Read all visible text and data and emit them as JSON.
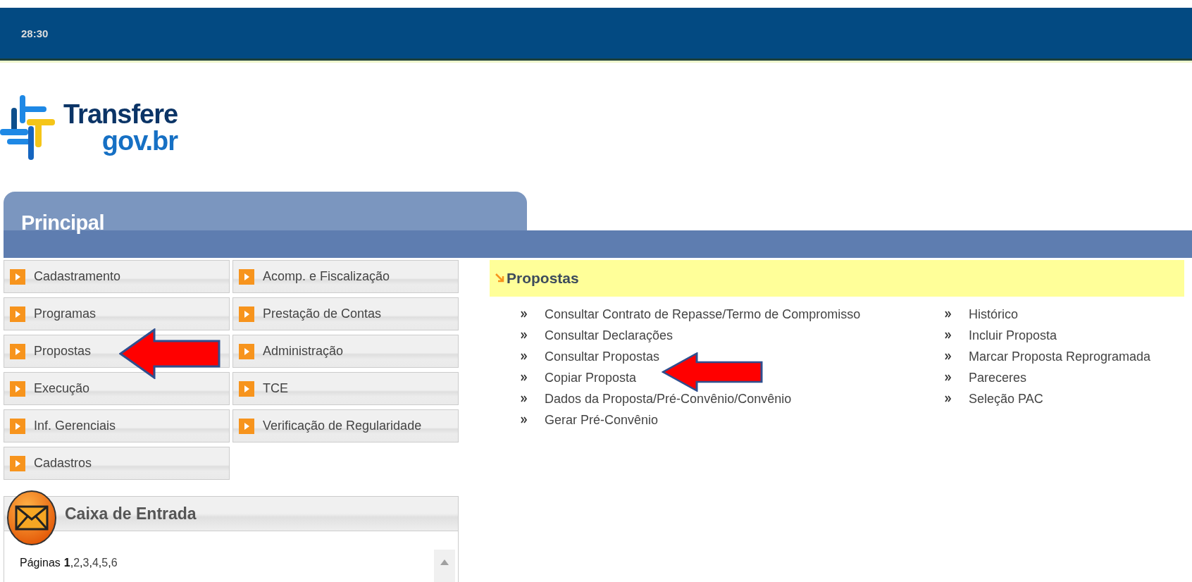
{
  "top_bar": {
    "timer": "28:30"
  },
  "logo": {
    "line_1": "Transfere",
    "line_2": "gov.br"
  },
  "section_tab": {
    "title": "Principal"
  },
  "menu": [
    {
      "label": "Cadastramento"
    },
    {
      "label": "Acomp. e Fiscalização"
    },
    {
      "label": "Programas"
    },
    {
      "label": "Prestação de Contas"
    },
    {
      "label": "Propostas"
    },
    {
      "label": "Administração"
    },
    {
      "label": "Execução"
    },
    {
      "label": "TCE"
    },
    {
      "label": "Inf. Gerenciais"
    },
    {
      "label": "Verificação de Regularidade"
    },
    {
      "label": "Cadastros"
    }
  ],
  "submenu": {
    "title": "Propostas",
    "columns": [
      [
        "Consultar Contrato de Repasse/Termo de Compromisso",
        "Consultar Declarações",
        "Consultar Propostas",
        "Copiar Proposta",
        "Dados da Proposta/Pré-Convênio/Convênio",
        "Gerar Pré-Convênio"
      ],
      [
        "Histórico",
        "Incluir Proposta",
        "Marcar Proposta Reprogramada",
        "Pareceres",
        "Seleção PAC"
      ]
    ]
  },
  "inbox": {
    "title": "Caixa de Entrada",
    "pages_label": "Páginas",
    "pages": [
      {
        "label": "1",
        "selected": true
      },
      {
        "label": "2",
        "selected": false
      },
      {
        "label": "3",
        "selected": false
      },
      {
        "label": "4",
        "selected": false
      },
      {
        "label": "5",
        "selected": false
      },
      {
        "label": "6",
        "selected": false
      }
    ],
    "separator": ","
  }
}
